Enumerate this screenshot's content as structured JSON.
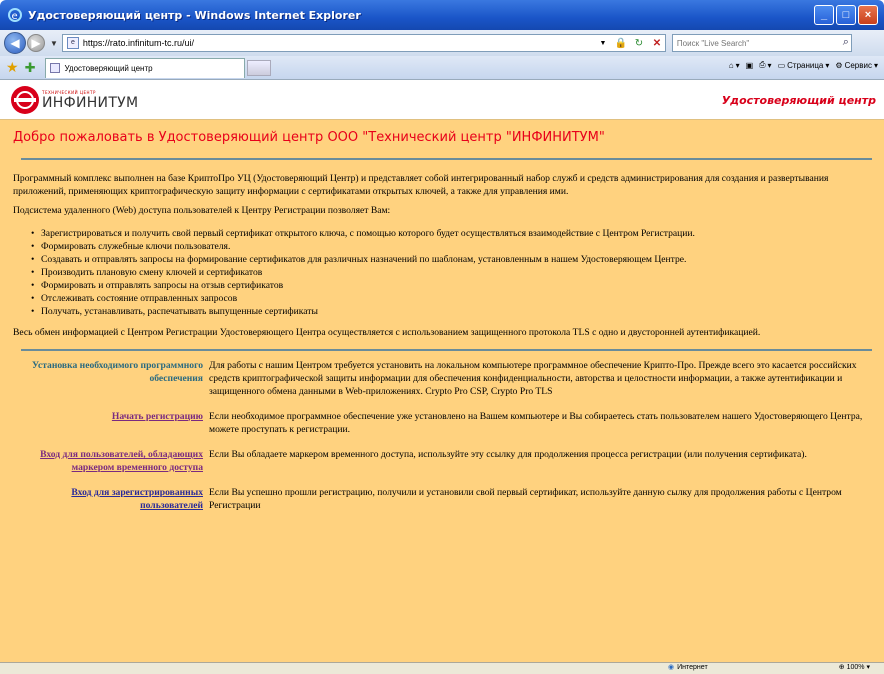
{
  "browser": {
    "window_title": "Удостоверяющий центр - Windows Internet Explorer",
    "url": "https://rato.infinitum-tc.ru/ui/",
    "search_placeholder": "Поиск \"Live Search\"",
    "tab_title": "Удостоверяющий центр",
    "commands": {
      "page": "Страница",
      "tools": "Сервис"
    },
    "status": {
      "zone": "Интернет",
      "zoom": "100%"
    }
  },
  "header": {
    "logo_small": "ТЕХНИЧЕСКИЙ ЦЕНТР",
    "logo_big": "ИНФИНИТУМ",
    "ca_title": "Удостоверяющий центр"
  },
  "content": {
    "welcome": "Добро пожаловать в Удостоверяющий центр ООО \"Технический центр \"ИНФИНИТУМ\"",
    "intro_1": "Программный комплекс выполнен на базе КриптоПро УЦ (Удостоверяющий Центр) и представляет собой интегрированный набор служб и средств администрирования для создания и развертывания приложений, применяющих криптографическую защиту информации с сертификатами открытых ключей, а также для управления ими.",
    "intro_2": "Подсистема удаленного (Web) доступа пользователей к Центру Регистрации позволяет Вам:",
    "features": [
      "Зарегистрироваться и получить свой первый сертификат открытого ключа, с помощью которого будет осуществляться взаимодействие с Центром Регистрации.",
      "Формировать служебные ключи пользователя.",
      "Создавать и отправлять запросы на формирование сертификатов для различных назначений по шаблонам, установленным в нашем Удостоверяющем Центре.",
      "Производить плановую смену ключей и сертификатов",
      "Формировать и отправлять запросы на отзыв сертификатов",
      "Отслеживать состояние отправленных запросов",
      "Получать, устанавливать, распечатывать выпущенные сертификаты"
    ],
    "exchange": "Весь обмен информацией с Центром Регистрации Удостоверяющего Центра осуществляется с использованием защищенного протокола TLS с одно и двусторонней аутентификацией.",
    "sections": [
      {
        "link": "Установка необходимого программного обеспечения",
        "desc": "Для работы с нашим Центром требуется установить на локальном компьютере программное обеспечение Крипто-Про. Прежде всего это касается российских средств криптографической защиты информации для обеспечения конфиденциальности, авторства и целостности информации, а также аутентификации и защищенного обмена данными в Web-приложениях. Crypto Pro CSP, Crypto Pro TLS"
      },
      {
        "link": "Начать регистрацию",
        "desc": "Если необходимое программное обеспечение уже установлено на Вашем компьютере и Вы собираетесь стать пользователем нашего Удостоверяющего Центра, можете проступать к регистрации."
      },
      {
        "link": "Вход для пользователей, обладающих маркером временного доступа",
        "desc": "Если Вы обладаете маркером временного доступа, используйте эту ссылку для продолжения процесса регистрации (или получения сертификата)."
      },
      {
        "link": "Вход для зарегистрированных пользователей",
        "desc": "Если Вы успешно прошли регистрацию, получили и установили свой первый сертификат, используйте данную сылку для продолжения работы с Центром Регистрации"
      }
    ]
  }
}
